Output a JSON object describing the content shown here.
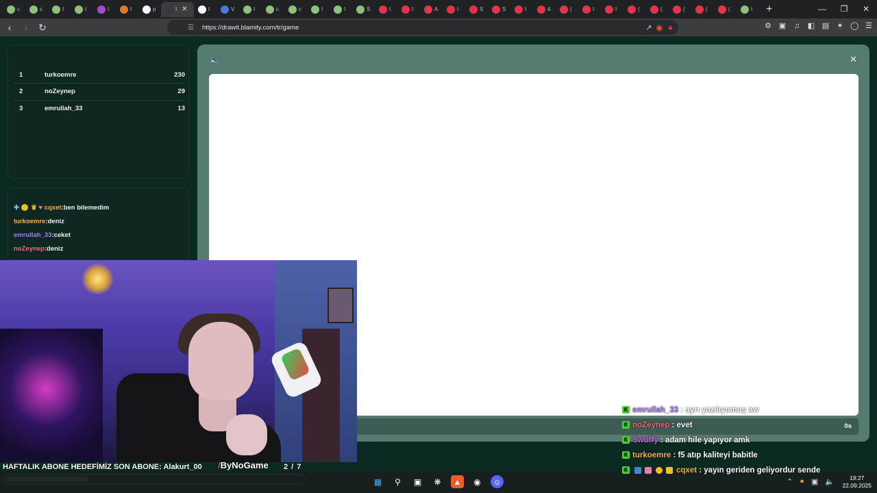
{
  "browser": {
    "tabs": [
      {
        "label": "c",
        "color": "#8fbf7a"
      },
      {
        "label": "c",
        "color": "#8fbf7a"
      },
      {
        "label": "I",
        "color": "#8fbf7a"
      },
      {
        "label": "I",
        "color": "#8fbf7a"
      },
      {
        "label": "I",
        "color": "#a04ad0"
      },
      {
        "label": "I",
        "color": "#e07a2a"
      },
      {
        "label": "p",
        "color": "#ffffff"
      },
      {
        "label": "I",
        "color": "#3a3a3a",
        "active": true
      },
      {
        "label": "I",
        "color": "#ffffff"
      },
      {
        "label": "V",
        "color": "#4a7ad0"
      },
      {
        "label": "I",
        "color": "#8fbf7a"
      },
      {
        "label": "c",
        "color": "#8fbf7a"
      },
      {
        "label": "c",
        "color": "#8fbf7a"
      },
      {
        "label": "I",
        "color": "#8fbf7a"
      },
      {
        "label": "I",
        "color": "#8fbf7a"
      },
      {
        "label": "S",
        "color": "#8fbf7a"
      },
      {
        "label": "I",
        "color": "#e0354a"
      },
      {
        "label": "I",
        "color": "#e0354a"
      },
      {
        "label": "A",
        "color": "#e0354a"
      },
      {
        "label": "I",
        "color": "#e0354a"
      },
      {
        "label": "S",
        "color": "#e0354a"
      },
      {
        "label": "S",
        "color": "#e0354a"
      },
      {
        "label": "I",
        "color": "#e0354a"
      },
      {
        "label": "4",
        "color": "#e0354a"
      },
      {
        "label": "(",
        "color": "#e0354a"
      },
      {
        "label": "I",
        "color": "#e0354a"
      },
      {
        "label": "I",
        "color": "#e0354a"
      },
      {
        "label": "(",
        "color": "#e0354a"
      },
      {
        "label": "(",
        "color": "#e0354a"
      },
      {
        "label": "(",
        "color": "#e0354a"
      },
      {
        "label": "(",
        "color": "#e0354a"
      },
      {
        "label": "(",
        "color": "#e0354a"
      },
      {
        "label": "I",
        "color": "#8fbf7a"
      }
    ],
    "new_tab": "+",
    "url": "https://drawit.blamity.com/tr/game"
  },
  "leaderboard": [
    {
      "rank": "1",
      "name": "turkoemre",
      "score": "230"
    },
    {
      "rank": "2",
      "name": "noZeynep",
      "score": "29"
    },
    {
      "rank": "3",
      "name": "emrullah_33",
      "score": "13"
    }
  ],
  "game_chat": [
    {
      "user": "cqxet",
      "text": ":ben bilemedim",
      "color": "#f0b24a"
    },
    {
      "user": "turkoemre",
      "text": ":deniz",
      "color": "#f0b24a"
    },
    {
      "user": "emrullah_33",
      "text": ":ceket",
      "color": "#a67cf0"
    },
    {
      "user": "noZeynep",
      "text": ":deniz",
      "color": "#ee6a7a"
    }
  ],
  "game": {
    "timer": "0s"
  },
  "overlay": {
    "sub_goal": "HAFTALIK ABONE HEDEFİMİZ SON ABONE: Alakurt_00",
    "brand": "ByNoGame",
    "goal_count": "2 / 7",
    "goal_progress": 0.28
  },
  "stream_chat": [
    {
      "user": "emrullah_33",
      "text": " : ayrı yazılıyomuş aw",
      "color": "#a67cf0"
    },
    {
      "user": "noZeynep",
      "text": " : evet",
      "color": "#ee6a7a"
    },
    {
      "user": "Swuffy",
      "text": " : adam hile yapıyor amk",
      "color": "#d05ae0"
    },
    {
      "user": "turkoemre",
      "text": " : f5 atıp kaliteyi babitle",
      "color": "#f0b24a"
    },
    {
      "user": "cqxet",
      "text": " : yayın geriden geliyordur sende",
      "color": "#f0b24a"
    }
  ],
  "taskbar": {
    "time": "19:27",
    "date": "22.09.2025"
  }
}
